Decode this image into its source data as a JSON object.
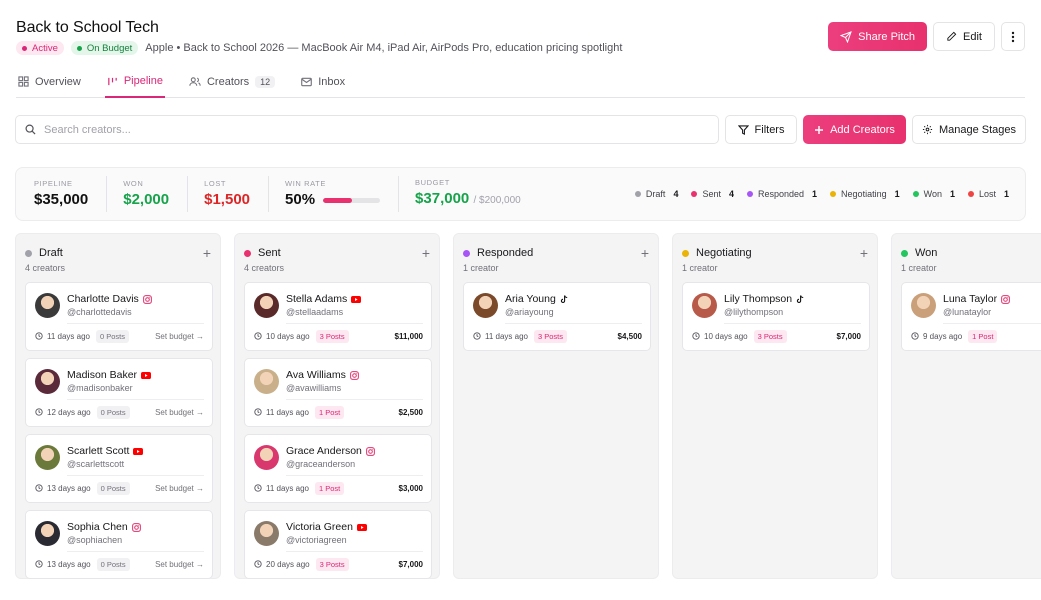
{
  "header": {
    "title": "Back to School Tech",
    "badges": {
      "active": "Active",
      "budget": "On Budget"
    },
    "subtitle": "Apple • Back to School 2026 — MacBook Air M4, iPad Air, AirPods Pro, education pricing spotlight",
    "share_label": "Share Pitch",
    "edit_label": "Edit"
  },
  "tabs": {
    "overview": "Overview",
    "pipeline": "Pipeline",
    "creators": "Creators",
    "creators_count": "12",
    "inbox": "Inbox"
  },
  "toolbar": {
    "search_placeholder": "Search creators...",
    "filters_label": "Filters",
    "add_label": "Add Creators",
    "manage_label": "Manage Stages"
  },
  "stats": {
    "pipeline": {
      "label": "PIPELINE",
      "value": "$35,000"
    },
    "won": {
      "label": "WON",
      "value": "$2,000"
    },
    "lost": {
      "label": "LOST",
      "value": "$1,500"
    },
    "winrate": {
      "label": "WIN RATE",
      "value": "50%",
      "fraction": 0.5
    },
    "budget": {
      "label": "BUDGET",
      "value": "$37,000",
      "total": "/ $200,000"
    }
  },
  "legend": [
    {
      "name": "Draft",
      "count": "4",
      "color": "#a1a1aa"
    },
    {
      "name": "Sent",
      "count": "4",
      "color": "#e8316e"
    },
    {
      "name": "Responded",
      "count": "1",
      "color": "#a855f7"
    },
    {
      "name": "Negotiating",
      "count": "1",
      "color": "#eab308"
    },
    {
      "name": "Won",
      "count": "1",
      "color": "#22c55e"
    },
    {
      "name": "Lost",
      "count": "1",
      "color": "#ef4444"
    }
  ],
  "columns": [
    {
      "name": "Draft",
      "count": "4 creators",
      "color": "#a1a1aa",
      "cards": [
        {
          "name": "Charlotte Davis",
          "handle": "@charlottedavis",
          "platform": "instagram",
          "time": "11 days ago",
          "posts": "0 Posts",
          "right": "Set budget →",
          "avatar": "#3a3a3a"
        },
        {
          "name": "Madison Baker",
          "handle": "@madisonbaker",
          "platform": "youtube",
          "time": "12 days ago",
          "posts": "0 Posts",
          "right": "Set budget →",
          "avatar": "#5b2a3a"
        },
        {
          "name": "Scarlett Scott",
          "handle": "@scarlettscott",
          "platform": "youtube",
          "time": "13 days ago",
          "posts": "0 Posts",
          "right": "Set budget →",
          "avatar": "#6b7a3a"
        },
        {
          "name": "Sophia Chen",
          "handle": "@sophiachen",
          "platform": "instagram",
          "time": "13 days ago",
          "posts": "0 Posts",
          "right": "Set budget →",
          "avatar": "#2a2a33"
        }
      ]
    },
    {
      "name": "Sent",
      "count": "4 creators",
      "color": "#e8316e",
      "cards": [
        {
          "name": "Stella Adams",
          "handle": "@stellaadams",
          "platform": "youtube",
          "time": "10 days ago",
          "posts": "3 Posts",
          "right": "$11,000",
          "avatar": "#5a2a2a"
        },
        {
          "name": "Ava Williams",
          "handle": "@avawilliams",
          "platform": "instagram",
          "time": "11 days ago",
          "posts": "1 Post",
          "right": "$2,500",
          "avatar": "#c9b08a"
        },
        {
          "name": "Grace Anderson",
          "handle": "@graceanderson",
          "platform": "instagram",
          "time": "11 days ago",
          "posts": "1 Post",
          "right": "$3,000",
          "avatar": "#d8386e"
        },
        {
          "name": "Victoria Green",
          "handle": "@victoriagreen",
          "platform": "youtube",
          "time": "20 days ago",
          "posts": "3 Posts",
          "right": "$7,000",
          "avatar": "#8a7a6a"
        }
      ]
    },
    {
      "name": "Responded",
      "count": "1 creator",
      "color": "#a855f7",
      "cards": [
        {
          "name": "Aria Young",
          "handle": "@ariayoung",
          "platform": "tiktok",
          "time": "11 days ago",
          "posts": "3 Posts",
          "right": "$4,500",
          "avatar": "#7a4a2a"
        }
      ]
    },
    {
      "name": "Negotiating",
      "count": "1 creator",
      "color": "#eab308",
      "cards": [
        {
          "name": "Lily Thompson",
          "handle": "@lilythompson",
          "platform": "tiktok",
          "time": "10 days ago",
          "posts": "3 Posts",
          "right": "$7,000",
          "avatar": "#b85a4a"
        }
      ]
    },
    {
      "name": "Won",
      "count": "1 creator",
      "color": "#22c55e",
      "cards": [
        {
          "name": "Luna Taylor",
          "handle": "@lunataylor",
          "platform": "instagram",
          "time": "9 days ago",
          "posts": "1 Post",
          "right": "",
          "avatar": "#c9a07a"
        }
      ]
    }
  ]
}
